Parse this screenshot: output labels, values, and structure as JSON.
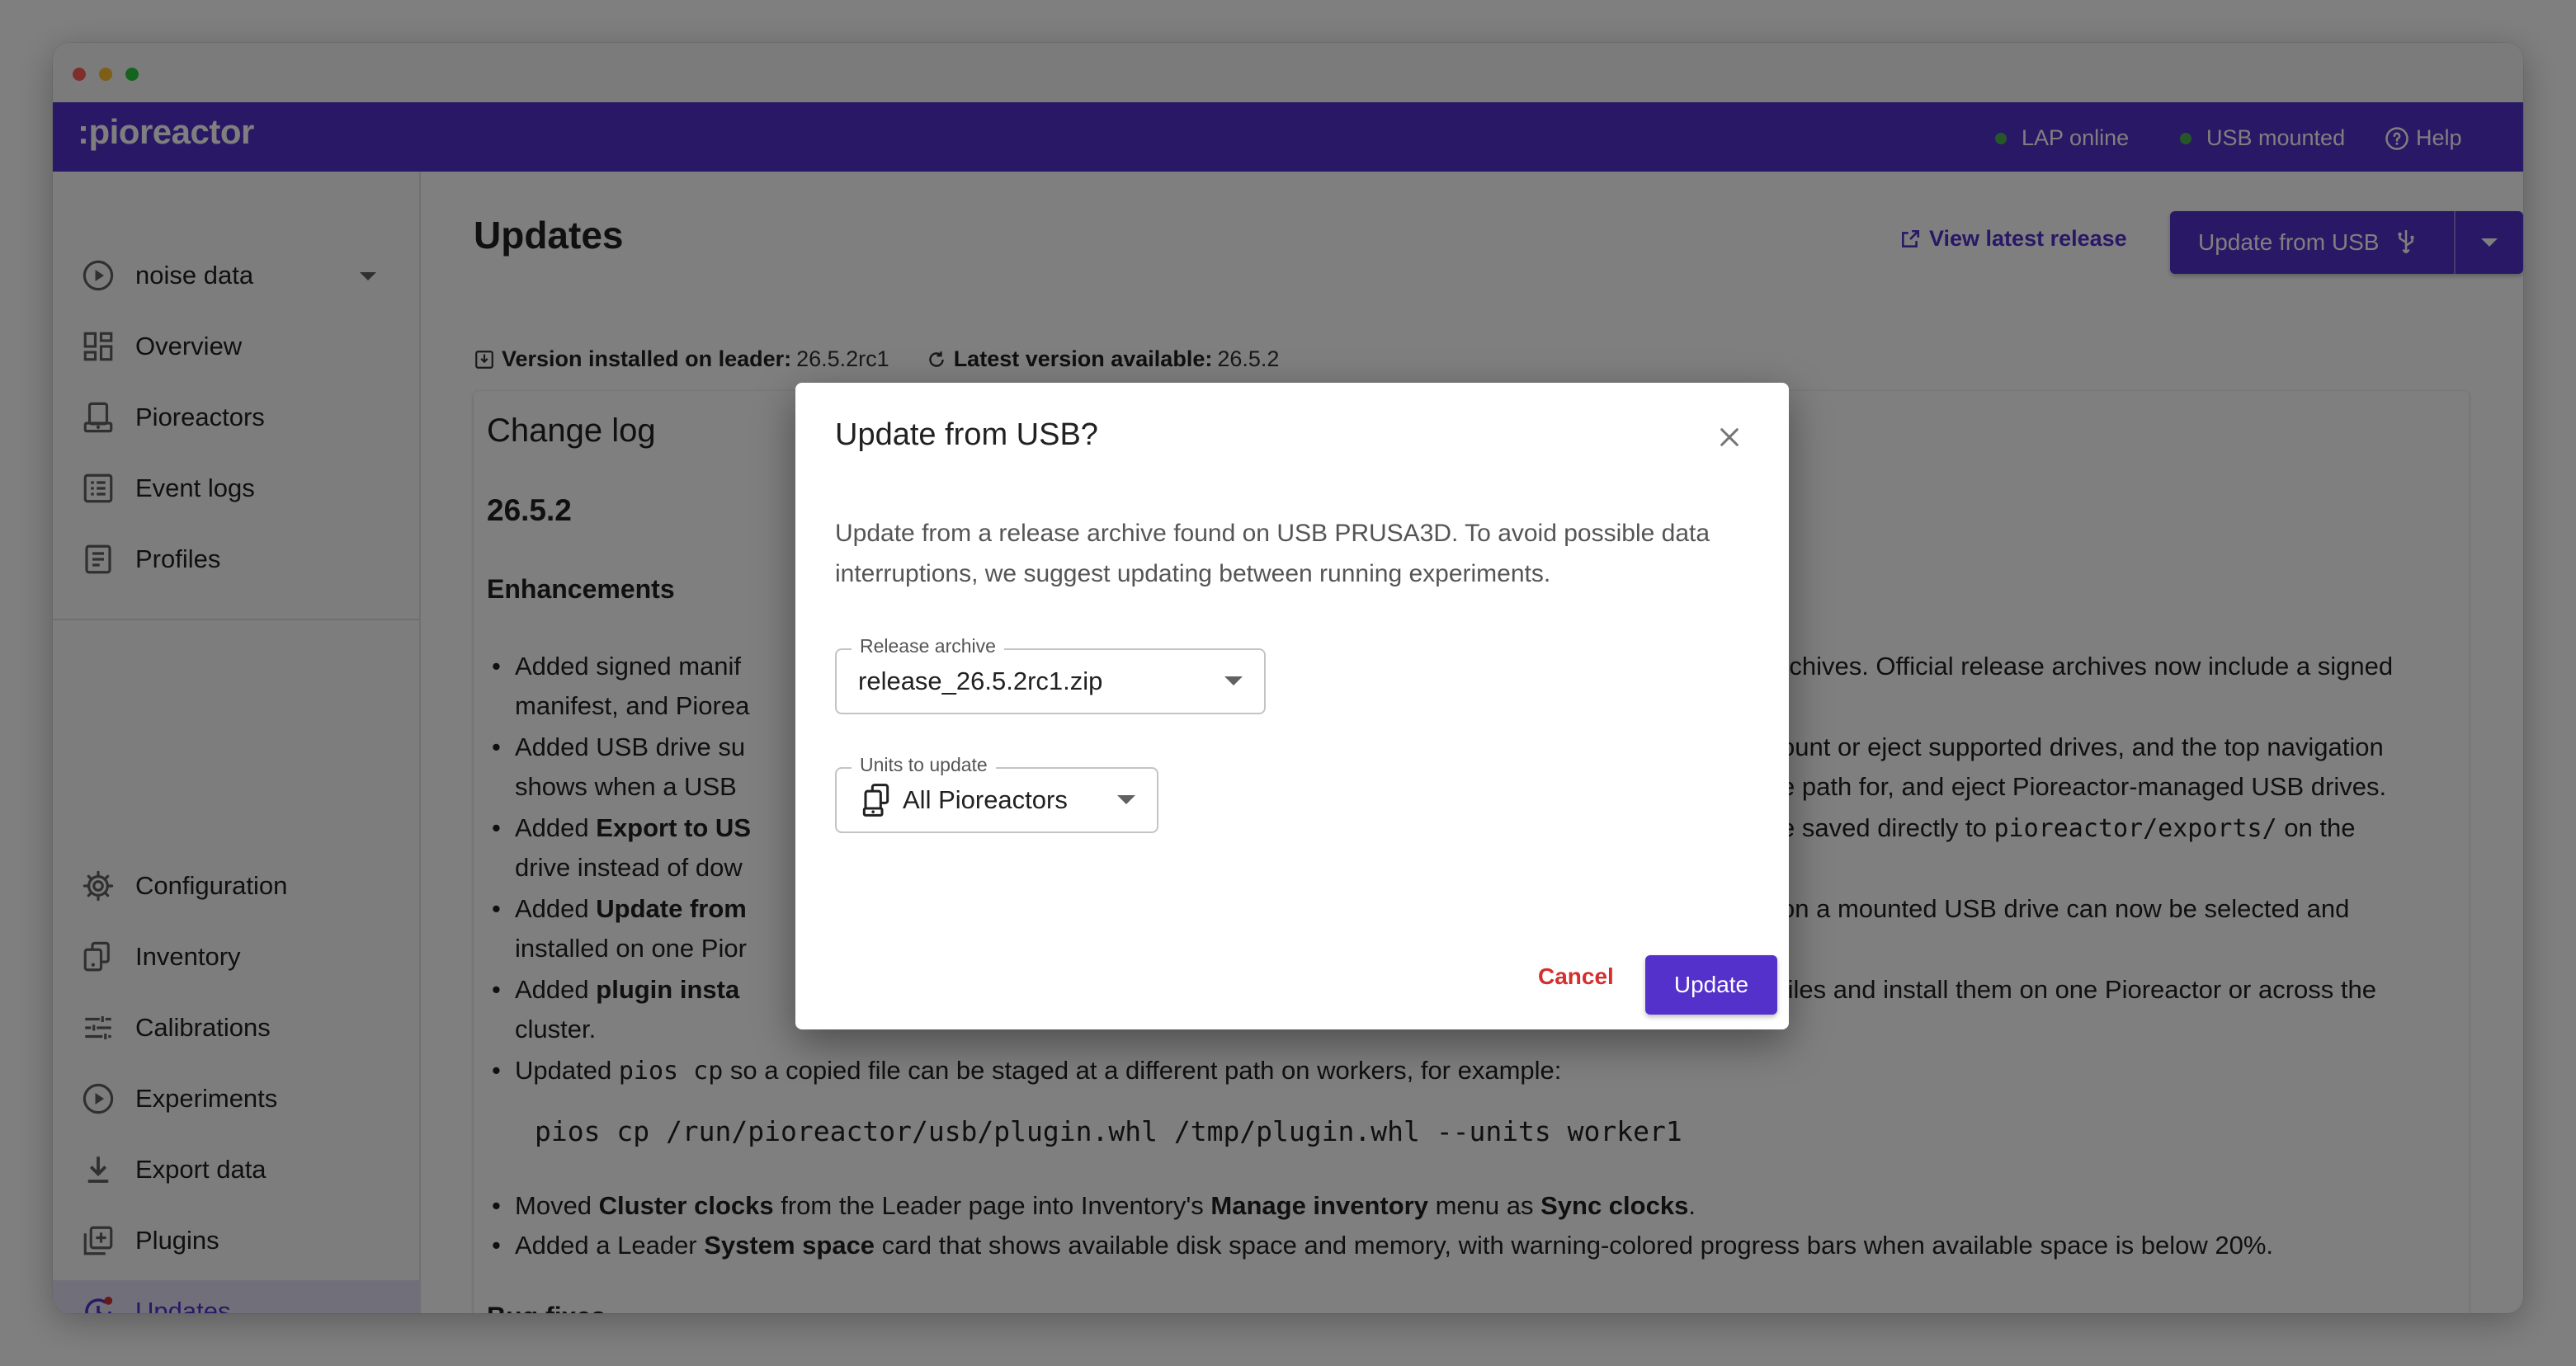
{
  "app": {
    "logo": ":pioreactor"
  },
  "statusbar": {
    "lap": "LAP online",
    "usb": "USB mounted",
    "help": "Help"
  },
  "colors": {
    "brand": "#5331ca",
    "online_dot": "#4caf50",
    "cancel": "#d32f2f"
  },
  "sidebar": {
    "experiment": "noise data",
    "top_items": [
      {
        "label": "Overview",
        "icon": "dashboard-icon"
      },
      {
        "label": "Pioreactors",
        "icon": "pioreactor-icon"
      },
      {
        "label": "Event logs",
        "icon": "list-icon"
      },
      {
        "label": "Profiles",
        "icon": "profile-icon"
      }
    ],
    "bottom_items": [
      {
        "label": "Configuration",
        "icon": "gear-icon"
      },
      {
        "label": "Inventory",
        "icon": "inventory-icon"
      },
      {
        "label": "Calibrations",
        "icon": "sliders-icon"
      },
      {
        "label": "Experiments",
        "icon": "play-circle-icon"
      },
      {
        "label": "Export data",
        "icon": "download-icon"
      },
      {
        "label": "Plugins",
        "icon": "plugin-icon"
      },
      {
        "label": "Updates",
        "icon": "update-icon"
      }
    ]
  },
  "page": {
    "title": "Updates",
    "view_latest": "View latest release",
    "update_usb": "Update from USB",
    "installed_label": "Version installed on leader:",
    "installed_value": "26.5.2rc1",
    "latest_label": "Latest version available:",
    "latest_value": "26.5.2"
  },
  "changelog": {
    "title": "Change log",
    "version": "26.5.2",
    "enh_heading": "Enhancements",
    "bug_heading": "Bug fixes",
    "b1": {
      "pre": "Added signed manif",
      "post": "rchives. Official release archives now include a signed",
      "l2": "manifest, and Piorea"
    },
    "b2": {
      "pre": "Added USB drive su",
      "post": "ount or eject supported drives, and the top navigation",
      "l2pre": "shows when a USB",
      "l2post": "e path for, and eject Pioreactor-managed USB drives."
    },
    "b3": {
      "pre": "Added ",
      "bold": "Export to US",
      "post1": "e saved directly to ",
      "code": "pioreactor/exports/",
      "post2": " on the",
      "l2": "drive instead of dow"
    },
    "b4": {
      "pre": "Added ",
      "bold": "Update from",
      "post": "on a mounted USB drive can now be selected and",
      "l2": "installed on one Pior"
    },
    "b5": {
      "pre": "Added ",
      "bold": "plugin insta",
      "post": "files and install them on one Pioreactor or across the",
      "l2": "cluster."
    },
    "b6": {
      "pre": "Updated ",
      "code": "pios cp",
      "post": " so a copied file can be staged at a different path on workers, for example:"
    },
    "code_line": "pios cp /run/pioreactor/usb/plugin.whl /tmp/plugin.whl --units worker1",
    "b7": {
      "pre": "Moved ",
      "b1": "Cluster clocks",
      "mid1": " from the Leader page into Inventory's ",
      "b2": "Manage inventory",
      "mid2": " menu as ",
      "b3": "Sync clocks",
      "end": "."
    },
    "b8": {
      "pre": "Added a Leader ",
      "bold": "System space",
      "post": " card that shows available disk space and memory, with warning-colored progress bars when available space is below 20%."
    }
  },
  "dialog": {
    "title": "Update from USB?",
    "body": "Update from a release archive found on USB PRUSA3D. To avoid possible data interruptions, we suggest updating between running experiments.",
    "archive_label": "Release archive",
    "archive_value": "release_26.5.2rc1.zip",
    "units_label": "Units to update",
    "units_value": "All Pioreactors",
    "cancel": "Cancel",
    "update": "Update"
  }
}
